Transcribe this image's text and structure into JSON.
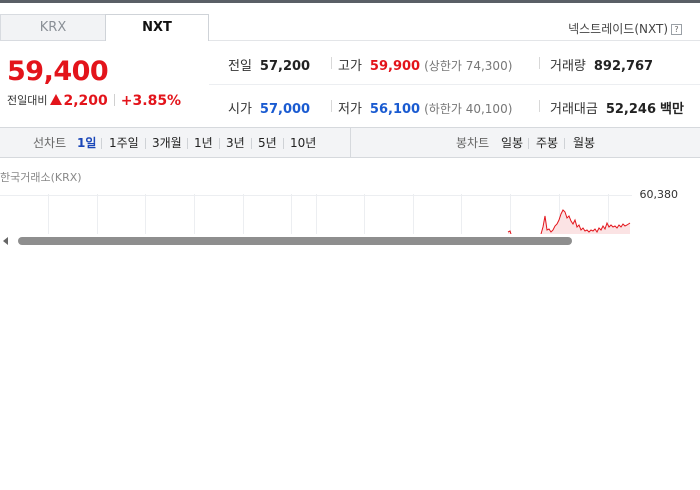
{
  "tabs": [
    {
      "label": "KRX",
      "active": false
    },
    {
      "label": "NXT",
      "active": true
    }
  ],
  "exchange": {
    "label": "넥스트레이드(NXT)",
    "help_icon": "?"
  },
  "quote": {
    "price": "59,400",
    "change_label": "전일대비",
    "change_icon": "up-triangle-icon",
    "change_value": "2,200",
    "change_rate": "+3.85%"
  },
  "stats": {
    "prev_close": {
      "label": "전일",
      "value": "57,200"
    },
    "high": {
      "label": "고가",
      "value": "59,900",
      "upper_limit": "(상한가 74,300)"
    },
    "volume": {
      "label": "거래량",
      "value": "892,767"
    },
    "open": {
      "label": "시가",
      "value": "57,000"
    },
    "low": {
      "label": "저가",
      "value": "56,100",
      "lower_limit": "(하한가 40,100)"
    },
    "trade_value": {
      "label": "거래대금",
      "value": "52,246",
      "unit": "백만"
    }
  },
  "toolbar": {
    "line_label": "선차트",
    "line_periods": [
      "1일",
      "1주일",
      "3개월",
      "1년",
      "3년",
      "5년",
      "10년"
    ],
    "active_period": "1일",
    "candle_label": "봉차트",
    "candle_periods": [
      "일봉",
      "주봉",
      "월봉"
    ]
  },
  "chart": {
    "source": "한국거래소(KRX)",
    "high_label": "60,380"
  },
  "colors": {
    "up": "#e3141b",
    "down": "#1a5bd1",
    "active": "#1a46b8"
  }
}
